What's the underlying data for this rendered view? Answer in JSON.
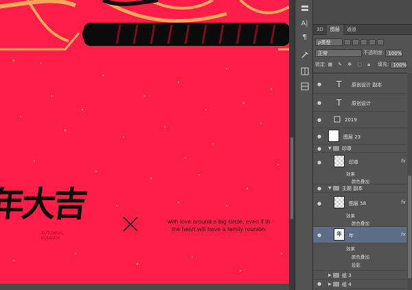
{
  "canvas": {
    "calligraphy": "年大吉",
    "season_line1": "AUTUMNAL",
    "season_line2": "EQUINOX",
    "tagline_line1": "with love around a big circle, even if th",
    "tagline_line2": "the heart will have a family reunion.",
    "background_color": "#ff1e48"
  },
  "toolbar": {
    "icons": [
      "layers-mini-icon",
      "text-tool-icon",
      "paragraph-icon",
      "tools-icon",
      "brush-icon",
      "transform-icon",
      "adjust-icon",
      "layer-comps-icon",
      "grid-icon"
    ],
    "labels": [
      "A|",
      "¶"
    ]
  },
  "panel": {
    "tabs": [
      "3D",
      "图层",
      "通道"
    ],
    "filter_label": "ρ类型",
    "blend_mode": "正常",
    "opacity_label": "不透明度:",
    "opacity_value": "100%",
    "lock_label": "锁定:",
    "fill_label": "填充:",
    "fill_value": "100%",
    "layers": [
      {
        "name": "原创设计 副本",
        "kind": "text"
      },
      {
        "name": "原创设计",
        "kind": "text"
      },
      {
        "name": "2019",
        "kind": "smart"
      },
      {
        "name": "图层 23",
        "kind": "pixel"
      },
      {
        "name": "印章",
        "kind": "group"
      },
      {
        "name": "印章",
        "kind": "pixel",
        "fx": "fx",
        "effects_label": "效果",
        "effects": [
          "颜色叠加"
        ]
      },
      {
        "name": "主题 副本",
        "kind": "group"
      },
      {
        "name": "图层 58",
        "kind": "pixel",
        "fx": "fx",
        "effects_label": "效果",
        "effects": [
          "颜色叠加"
        ]
      },
      {
        "name": "年",
        "kind": "pixel",
        "selected": true,
        "fx": "fx",
        "effects_label": "效果",
        "effects": [
          "颜色叠加",
          "投影"
        ]
      },
      {
        "name": "组 3",
        "kind": "group"
      },
      {
        "name": "组 4",
        "kind": "group"
      }
    ]
  }
}
